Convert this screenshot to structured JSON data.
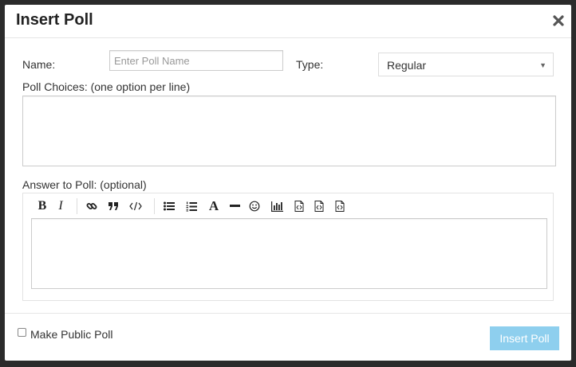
{
  "dialog": {
    "title": "Insert Poll",
    "close_icon": "close-icon"
  },
  "form": {
    "name_label": "Name:",
    "name_placeholder": "Enter Poll Name",
    "name_value": "",
    "type_label": "Type:",
    "type_selected": "Regular",
    "choices_label": "Poll Choices: (one option per line)",
    "choices_value": "",
    "answer_label": "Answer to Poll: (optional)",
    "answer_value": ""
  },
  "toolbar": {
    "icons": [
      "bold-icon",
      "italic-icon",
      "link-icon",
      "quote-icon",
      "code-icon",
      "bulleted-list-icon",
      "numbered-list-icon",
      "font-icon",
      "horizontal-rule-icon",
      "emoji-icon",
      "chart-icon",
      "file-code-icon",
      "file-code-icon",
      "file-code-icon"
    ],
    "bold_text": "B",
    "italic_text": "I",
    "font_text": "A"
  },
  "footer": {
    "public_label": "Make Public Poll",
    "public_checked": false,
    "insert_label": "Insert Poll",
    "insert_color": "#8ecfee"
  }
}
